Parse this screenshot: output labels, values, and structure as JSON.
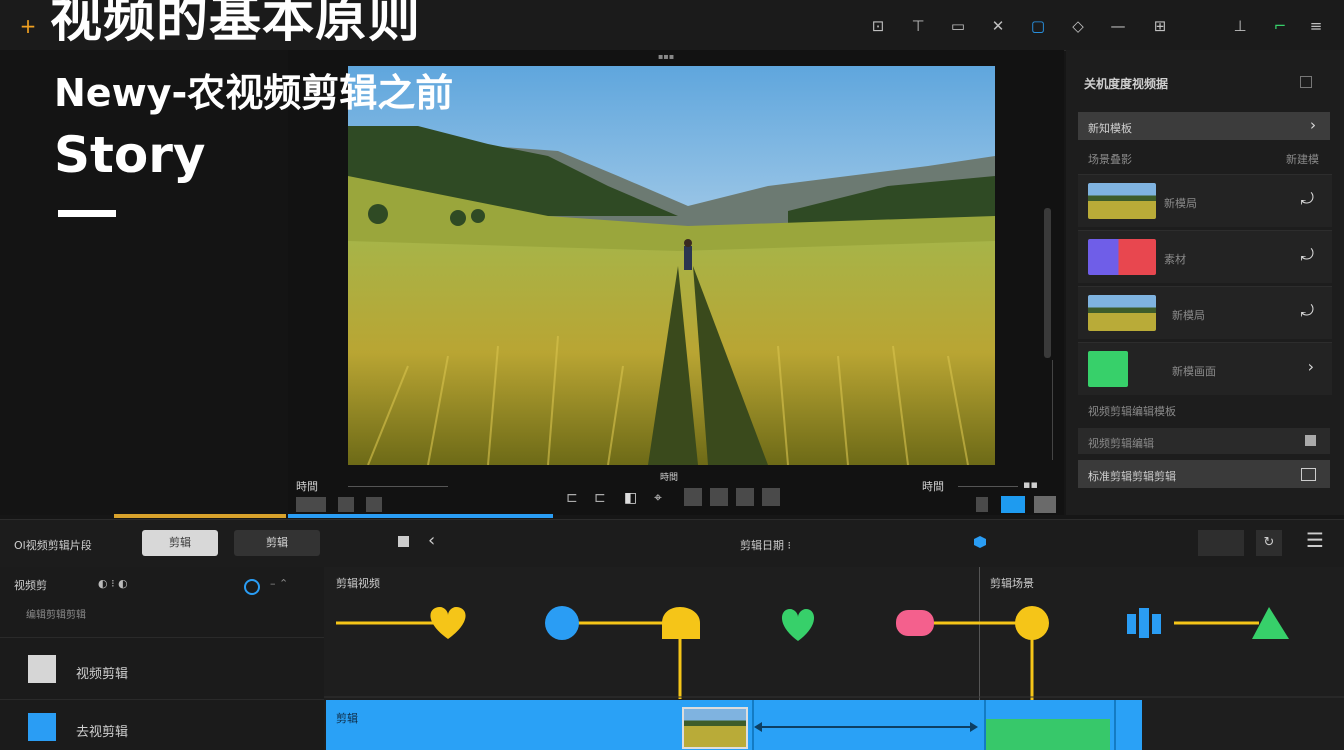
{
  "overlay": {
    "title": "视频的基本原则",
    "subtitle": "Newy-农视频剪辑之前",
    "story": "Story"
  },
  "preview": {
    "top_label": "▪▪▪",
    "bottom_left": "時間",
    "bottom_center": "時間",
    "bottom_right": "時間"
  },
  "right_panel": {
    "header": "关机度度视频据",
    "selected_item": "新知模板",
    "section_label": "场景叠影",
    "section_right": "新建模",
    "items": [
      {
        "label": "新模局",
        "thumb": "field"
      },
      {
        "label": "素材",
        "thumb": "color"
      },
      {
        "label": "新模局",
        "thumb": "field"
      },
      {
        "label": "新模画面",
        "thumb": "green"
      }
    ],
    "footer_label": "视频剪辑编辑模板",
    "opt1": "视频剪辑编辑",
    "opt2": "标准剪辑剪辑剪辑"
  },
  "timeline": {
    "title": "Ol视频剪辑片段",
    "btn1": "剪辑",
    "btn2": "剪辑",
    "timecode": "剪辑日期 ⁝",
    "left_label": "视频剪",
    "left_sub": "编辑剪辑剪辑",
    "track1": "视频剪辑",
    "track2": "去视剪辑",
    "ruler_label1": "剪辑视频",
    "ruler_label2": "剪辑场景",
    "clip_label": "剪辑"
  },
  "colors": {
    "accent": "#2a9df4",
    "yellow": "#f5c518",
    "green": "#37d06a",
    "pink": "#f4608d"
  }
}
